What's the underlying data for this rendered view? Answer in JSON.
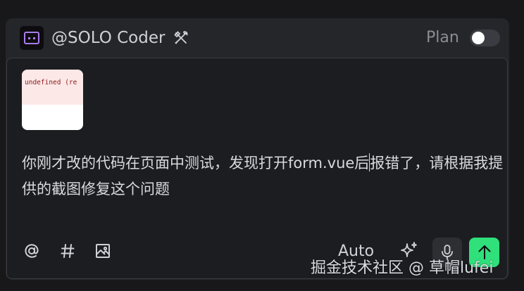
{
  "header": {
    "agent_name": "@SOLO Coder",
    "agent_icon": "robot-face-icon",
    "tools_icon": "tools-icon",
    "plan_label": "Plan",
    "plan_toggle_on": false
  },
  "attachment": {
    "thumbnail_text": "undefined (re"
  },
  "input": {
    "message_before_cursor": "你刚才改的代码在页面中测试，发现打开form.vue后",
    "message_after_cursor": "报错了，请根据我提供的截图修复这个问题"
  },
  "toolbar": {
    "mention_icon": "at-icon",
    "hash_icon": "hash-icon",
    "image_icon": "image-icon",
    "auto_label": "Auto",
    "sparkle_icon": "sparkle-icon",
    "mic_icon": "microphone-icon",
    "send_icon": "arrow-up-icon"
  },
  "watermark": "掘金技术社区 @ 草帽lufei",
  "colors": {
    "background": "#18181b",
    "panel": "#252629",
    "input": "#1c1d20",
    "send_button": "#2fe07b"
  }
}
